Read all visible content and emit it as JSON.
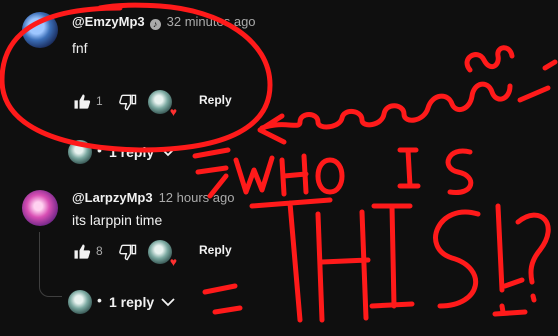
{
  "comments": [
    {
      "author": "@EmzyMp3",
      "verified": true,
      "time": "32 minutes ago",
      "text": "fnf",
      "likes": "1",
      "reply_label": "Reply",
      "replies_label": "1 reply"
    },
    {
      "author": "@LarpzyMp3",
      "verified": false,
      "time": "12 hours ago",
      "text": "its larppin time",
      "likes": "8",
      "reply_label": "Reply",
      "replies_label": "1 reply"
    }
  ],
  "icons": {
    "like": "thumbs-up-icon",
    "dislike": "thumbs-down-icon",
    "expand": "chevron-down-icon",
    "heart": "heart-icon"
  },
  "colors": {
    "background": "#0f0f0f",
    "annotation": "#ff1a1a",
    "heart": "#ff3030"
  },
  "annotation_text": "WHO IS THIS!?"
}
